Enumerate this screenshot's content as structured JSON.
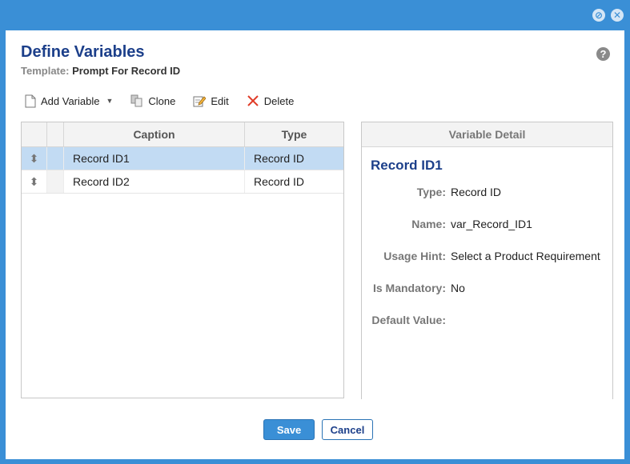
{
  "window": {
    "minimize_glyph": "⊘",
    "close_glyph": "✕"
  },
  "header": {
    "title": "Define Variables",
    "template_label": "Template:",
    "template_value": "Prompt For Record ID",
    "help_glyph": "?"
  },
  "toolbar": {
    "add_label": "Add Variable",
    "clone_label": "Clone",
    "edit_label": "Edit",
    "delete_label": "Delete"
  },
  "grid": {
    "columns": [
      "Caption",
      "Type"
    ],
    "rows": [
      {
        "caption": "Record ID1",
        "type": "Record ID"
      },
      {
        "caption": "Record ID2",
        "type": "Record ID"
      }
    ]
  },
  "detail": {
    "header": "Variable Detail",
    "title": "Record ID1",
    "fields": [
      {
        "label": "Type:",
        "value": "Record ID"
      },
      {
        "label": "Name:",
        "value": "var_Record_ID1"
      },
      {
        "label": "Usage Hint:",
        "value": "Select a Product Requirement"
      },
      {
        "label": "Is Mandatory:",
        "value": "No"
      },
      {
        "label": "Default Value:",
        "value": ""
      }
    ]
  },
  "footer": {
    "save_label": "Save",
    "cancel_label": "Cancel"
  },
  "colors": {
    "accent": "#3a8fd6",
    "title": "#1c3f8a",
    "selected_row": "#c2dbf3",
    "delete_icon": "#e03c28"
  }
}
